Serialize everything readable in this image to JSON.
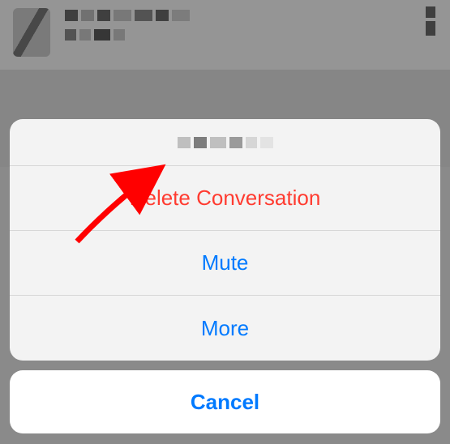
{
  "actionsheet": {
    "delete_label": "Delete Conversation",
    "mute_label": "Mute",
    "more_label": "More",
    "cancel_label": "Cancel"
  },
  "colors": {
    "destructive": "#ff3b30",
    "tint": "#007aff"
  }
}
